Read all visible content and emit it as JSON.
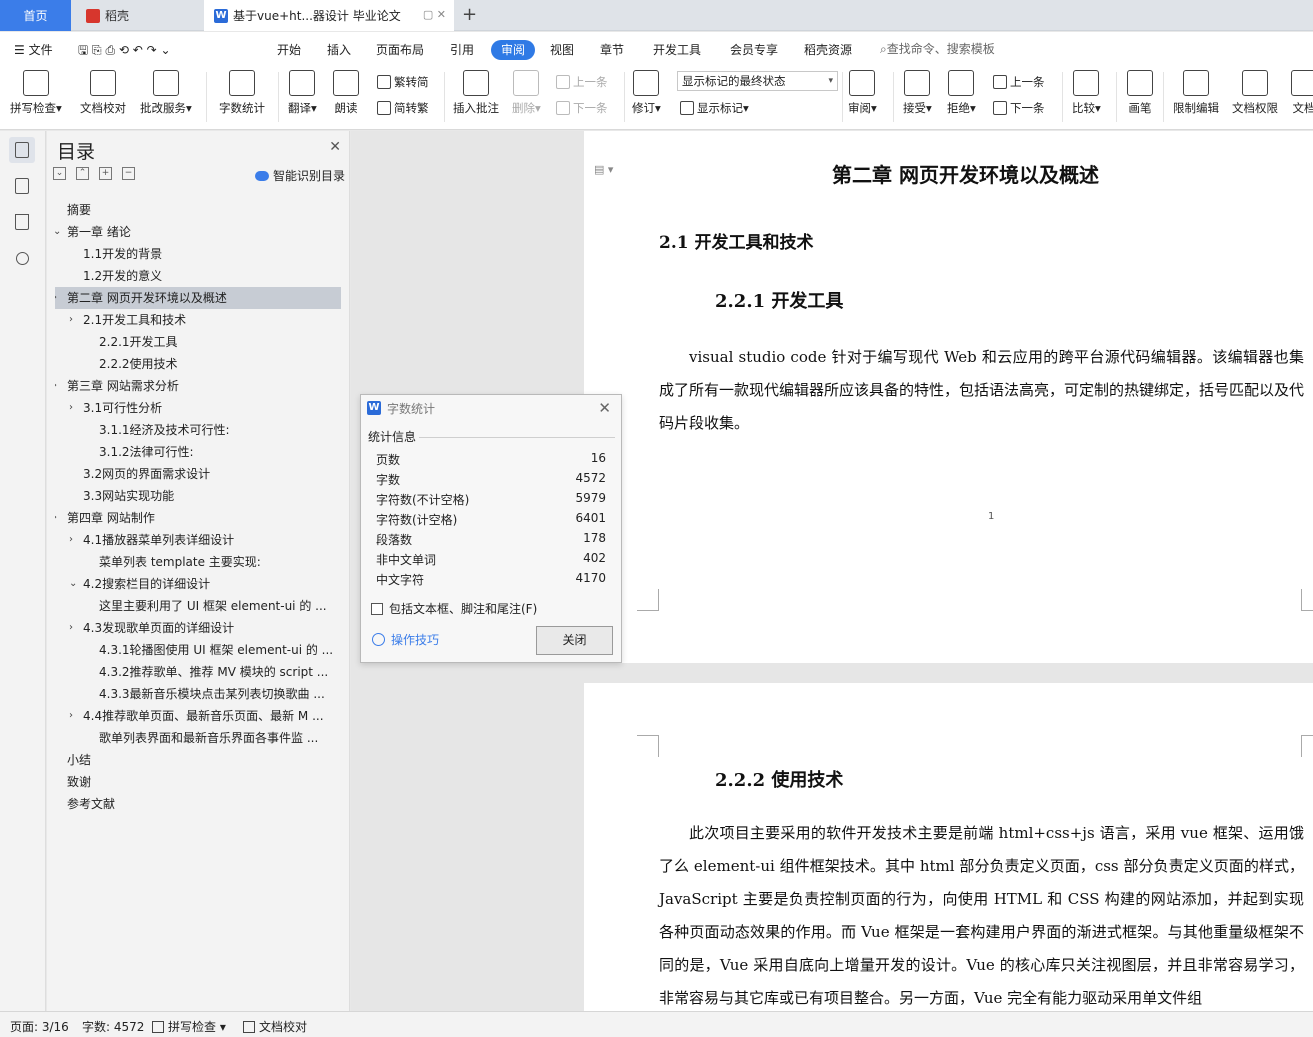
{
  "tabs": {
    "home": "首页",
    "daoke": "稻壳",
    "doc": "基于vue+ht...器设计 毕业论文"
  },
  "menu": {
    "file": "文件",
    "items": [
      "开始",
      "插入",
      "页面布局",
      "引用",
      "审阅",
      "视图",
      "章节",
      "开发工具",
      "会员专享",
      "稻壳资源"
    ],
    "active": "审阅",
    "search": "查找命令、搜索模板"
  },
  "ribbon": {
    "spellcheck": "拼写检查",
    "doc_proof": "文档校对",
    "batch_service": "批改服务",
    "word_count": "字数统计",
    "translate": "翻译",
    "read_aloud": "朗读",
    "to_traditional": "繁转简",
    "to_simplified": "简转繁",
    "insert_comment": "插入批注",
    "delete": "删除",
    "prev_comment": "上一条",
    "next_comment": "下一条",
    "revise": "修订",
    "markup_state": "显示标记的最终状态",
    "show_markup": "显示标记",
    "review": "审阅",
    "accept": "接受",
    "reject": "拒绝",
    "prev": "上一条",
    "next": "下一条",
    "compare": "比较",
    "pen": "画笔",
    "restrict_edit": "限制编辑",
    "doc_permission": "文档权限",
    "doc_more": "文档"
  },
  "toc": {
    "title": "目录",
    "smart": "智能识别目录",
    "items": [
      {
        "label": "摘要",
        "level": 0,
        "arrow": ""
      },
      {
        "label": "第一章  绪论",
        "level": 0,
        "arrow": "down"
      },
      {
        "label": "1.1开发的背景",
        "level": 1,
        "arrow": ""
      },
      {
        "label": "1.2开发的意义",
        "level": 1,
        "arrow": ""
      },
      {
        "label": "第二章  网页开发环境以及概述",
        "level": 0,
        "arrow": "right",
        "selected": true
      },
      {
        "label": "2.1开发工具和技术",
        "level": 1,
        "arrow": "right"
      },
      {
        "label": "2.2.1开发工具",
        "level": 2,
        "arrow": ""
      },
      {
        "label": "2.2.2使用技术",
        "level": 2,
        "arrow": ""
      },
      {
        "label": "第三章  网站需求分析",
        "level": 0,
        "arrow": "right"
      },
      {
        "label": "3.1可行性分析",
        "level": 1,
        "arrow": "right"
      },
      {
        "label": "3.1.1经济及技术可行性:",
        "level": 2,
        "arrow": ""
      },
      {
        "label": "3.1.2法律可行性:",
        "level": 2,
        "arrow": ""
      },
      {
        "label": "3.2网页的界面需求设计",
        "level": 1,
        "arrow": ""
      },
      {
        "label": "3.3网站实现功能",
        "level": 1,
        "arrow": ""
      },
      {
        "label": "第四章  网站制作",
        "level": 0,
        "arrow": "right"
      },
      {
        "label": "4.1播放器菜单列表详细设计",
        "level": 1,
        "arrow": "right"
      },
      {
        "label": "菜单列表 template 主要实现:",
        "level": 2,
        "arrow": ""
      },
      {
        "label": "4.2搜索栏目的详细设计",
        "level": 1,
        "arrow": "down"
      },
      {
        "label": "这里主要利用了 UI 框架 element-ui 的 ...",
        "level": 2,
        "arrow": ""
      },
      {
        "label": "4.3发现歌单页面的详细设计",
        "level": 1,
        "arrow": "right"
      },
      {
        "label": "4.3.1轮播图使用 UI 框架 element-ui 的 ...",
        "level": 2,
        "arrow": ""
      },
      {
        "label": "4.3.2推荐歌单、推荐 MV 模块的 script ...",
        "level": 2,
        "arrow": ""
      },
      {
        "label": "4.3.3最新音乐模块点击某列表切换歌曲 ...",
        "level": 2,
        "arrow": ""
      },
      {
        "label": "4.4推荐歌单页面、最新音乐页面、最新 M ...",
        "level": 1,
        "arrow": "right"
      },
      {
        "label": "歌单列表界面和最新音乐界面各事件监 ...",
        "level": 2,
        "arrow": ""
      },
      {
        "label": "小结",
        "level": 0,
        "arrow": ""
      },
      {
        "label": "致谢",
        "level": 0,
        "arrow": ""
      },
      {
        "label": "参考文献",
        "level": 0,
        "arrow": ""
      }
    ]
  },
  "doc": {
    "chapter": "第二章   网页开发环境以及概述",
    "h21": "2.1 开发工具和技术",
    "h221": "2.2.1   开发工具",
    "p1": "visual studio code 针对于编写现代 Web 和云应用的跨平台源代码编辑器。该编辑器也集成了所有一款现代编辑器所应该具备的特性，包括语法高亮，可定制的热键绑定，括号匹配以及代码片段收集。",
    "page_number": "1",
    "h222": "2.2.2   使用技术",
    "p2": "此次项目主要采用的软件开发技术主要是前端 html+css+js 语言，采用 vue 框架、运用饿了么 element-ui 组件框架技术。其中 html 部分负责定义页面，css 部分负责定义页面的样式，JavaScript 主要是负责控制页面的行为，向使用 HTML 和 CSS 构建的网站添加，并起到实现各种页面动态效果的作用。而 Vue 框架是一套构建用户界面的渐进式框架。与其他重量级框架不同的是，Vue 采用自底向上增量开发的设计。Vue 的核心库只关注视图层，并且非常容易学习，非常容易与其它库或已有项目整合。另一方面，Vue 完全有能力驱动采用单文件组"
  },
  "word_count_dialog": {
    "title": "字数统计",
    "section": "统计信息",
    "rows": [
      {
        "label": "页数",
        "value": "16"
      },
      {
        "label": "字数",
        "value": "4572"
      },
      {
        "label": "字符数(不计空格)",
        "value": "5979"
      },
      {
        "label": "字符数(计空格)",
        "value": "6401"
      },
      {
        "label": "段落数",
        "value": "178"
      },
      {
        "label": "非中文单词",
        "value": "402"
      },
      {
        "label": "中文字符",
        "value": "4170"
      }
    ],
    "include_label": "包括文本框、脚注和尾注(F)",
    "include_checked": false,
    "tips": "操作技巧",
    "close": "关闭"
  },
  "status": {
    "page": "页面: 3/16",
    "words": "字数: 4572",
    "spell": "拼写检查",
    "proof": "文档校对"
  },
  "colors": {
    "accent": "#2f7ae5",
    "home_tab": "#3b7de9",
    "link": "#3b7de9"
  }
}
